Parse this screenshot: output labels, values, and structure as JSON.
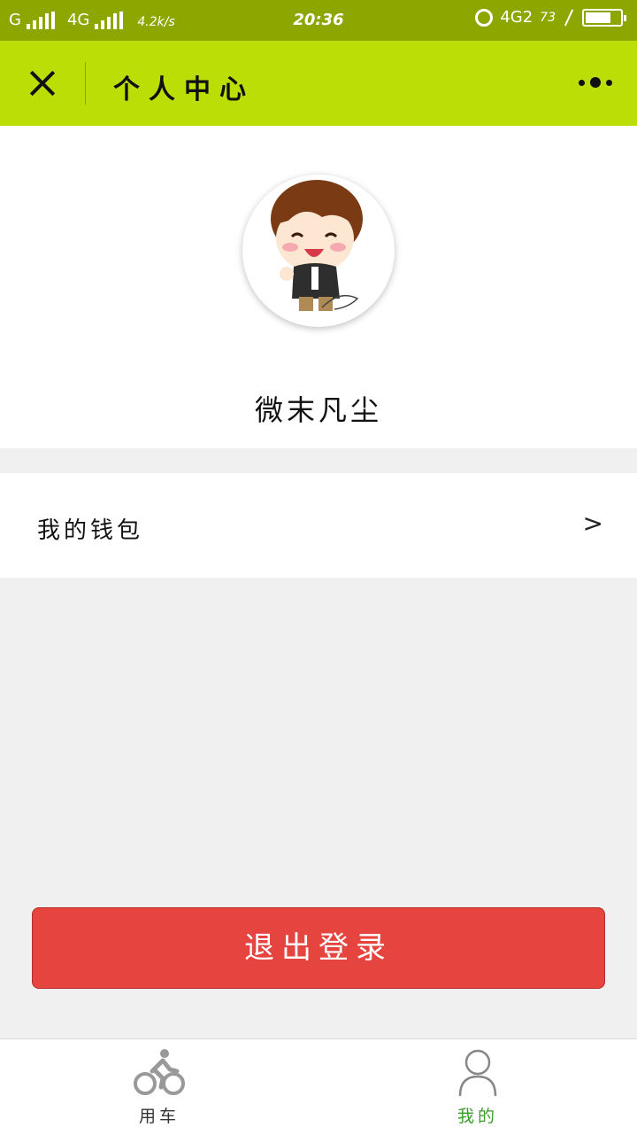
{
  "status_bar": {
    "carrier1": "G",
    "carrier2": "4G",
    "speed": "4.2k/s",
    "time": "20:36",
    "network": "4G2",
    "battery_percent": "73"
  },
  "header": {
    "title": "个人中心"
  },
  "profile": {
    "username": "微末凡尘"
  },
  "wallet": {
    "label": "我的钱包",
    "chevron": ">"
  },
  "logout": {
    "label": "退出登录"
  },
  "tabbar": {
    "tabs": [
      {
        "label": "用车",
        "icon": "bicycle-icon",
        "active": false
      },
      {
        "label": "我的",
        "icon": "person-icon",
        "active": true
      }
    ]
  },
  "colors": {
    "status_bar": "#8ea700",
    "header": "#bbdf06",
    "logout_button": "#e5443f",
    "active_tab": "#3a9d2a"
  }
}
